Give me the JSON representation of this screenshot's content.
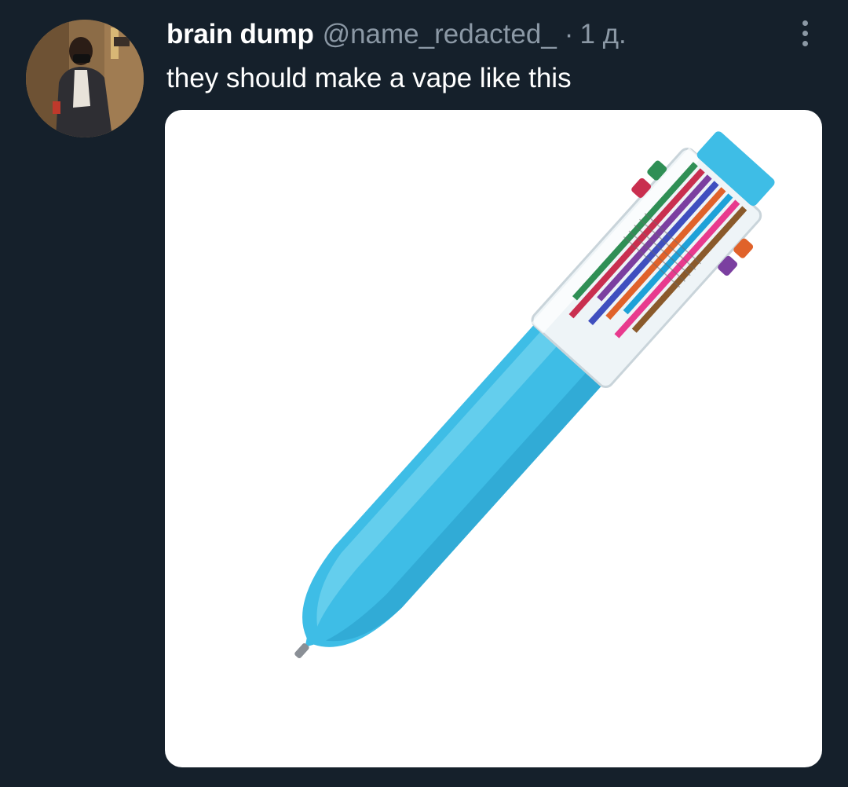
{
  "tweet": {
    "display_name": "brain dump",
    "handle": "@name_redacted_",
    "separator": "·",
    "timestamp": "1 д.",
    "text": "they should make a vape like this"
  },
  "icons": {
    "more": "more-options-icon"
  },
  "colors": {
    "background": "#15202b",
    "secondary_text": "#8b98a5",
    "pen_blue": "#3ebde6"
  }
}
